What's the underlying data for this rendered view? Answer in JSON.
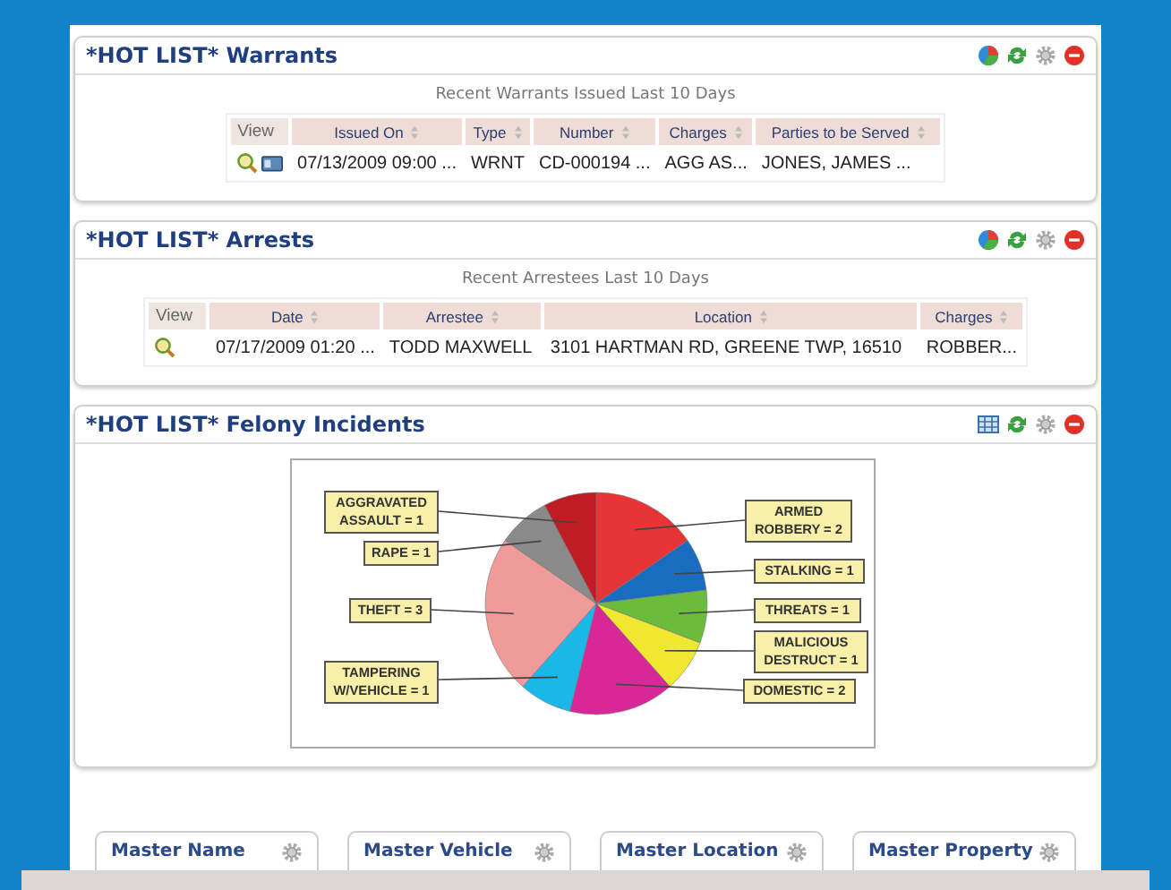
{
  "panels": [
    {
      "kind": "table",
      "title": "*HOT LIST* Warrants",
      "subtitle": "Recent Warrants Issued Last 10 Days",
      "columns": [
        "View",
        "Issued On",
        "Type",
        "Number",
        "Charges",
        "Parties to be Served"
      ],
      "rows": [
        {
          "cells": [
            "",
            "07/13/2009 09:00 ...",
            "WRNT",
            "CD-000194 ...",
            "AGG AS...",
            "JONES, JAMES ..."
          ]
        }
      ]
    },
    {
      "kind": "table",
      "title": "*HOT LIST* Arrests",
      "subtitle": "Recent Arrestees Last 10 Days",
      "columns": [
        "View",
        "Date",
        "Arrestee",
        "Location",
        "Charges"
      ],
      "rows": [
        {
          "cells": [
            "",
            "07/17/2009 01:20 ...",
            "TODD MAXWELL",
            "3101 HARTMAN RD, GREENE TWP, 16510",
            "ROBBER..."
          ]
        }
      ]
    },
    {
      "kind": "chart",
      "title": "*HOT LIST* Felony Incidents",
      "chart_data": {
        "type": "pie",
        "values": [
          2,
          1,
          1,
          1,
          2,
          1,
          3,
          1,
          1
        ],
        "value_labels": [
          "ARMED ROBBERY = 2",
          "STALKING = 1",
          "THREATS = 1",
          "MALICIOUS DESTRUCT = 1",
          "DOMESTIC = 2",
          "TAMPERING W/VEHICLE = 1",
          "THEFT = 3",
          "RAPE = 1",
          "AGGRAVATED ASSAULT = 1"
        ]
      }
    }
  ],
  "tabs": [
    "Master Name",
    "Master Vehicle",
    "Master Location",
    "Master Property"
  ]
}
